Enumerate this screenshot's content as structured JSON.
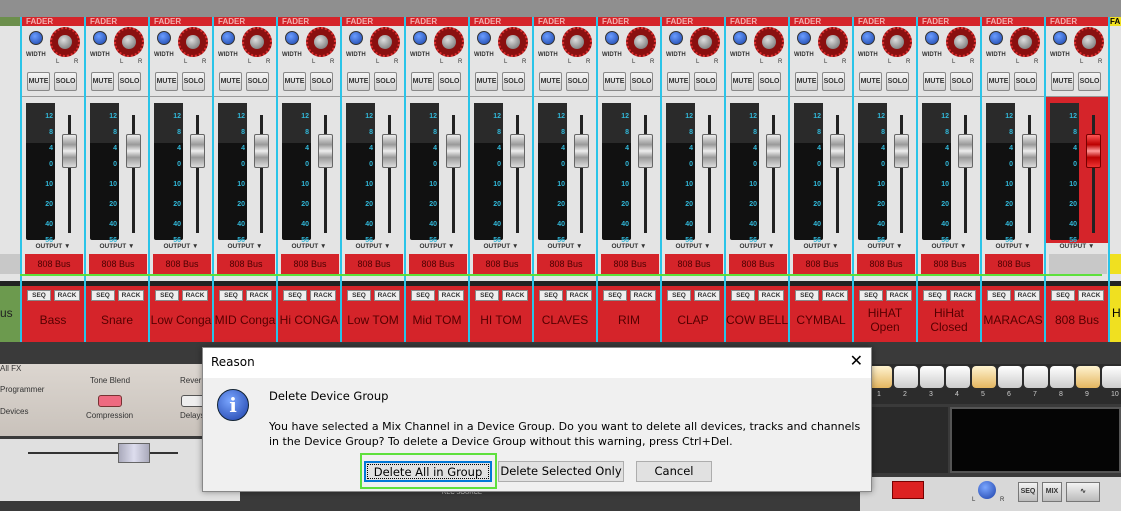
{
  "mixer": {
    "header_label": "FADER",
    "width_label": "WIDTH",
    "pan_l": "L",
    "pan_r": "R",
    "mute_label": "MUTE",
    "solo_label": "SOLO",
    "meter_scale": [
      "12",
      "8",
      "4",
      "0",
      "10",
      "20",
      "40",
      "56"
    ],
    "output_label": "OUTPUT",
    "seq_label": "SEQ",
    "rack_label": "RACK",
    "left_partial_name": "us",
    "right_partial_name": "H",
    "right_partial_header": "FA",
    "channels": [
      {
        "name": "Bass",
        "output": "808 Bus"
      },
      {
        "name": "Snare",
        "output": "808 Bus"
      },
      {
        "name": "Low Conga",
        "output": "808 Bus"
      },
      {
        "name": "MID Conga",
        "output": "808 Bus"
      },
      {
        "name": "Hi CONGA",
        "output": "808 Bus"
      },
      {
        "name": "Low TOM",
        "output": "808 Bus"
      },
      {
        "name": "Mid TOM",
        "output": "808 Bus"
      },
      {
        "name": "HI TOM",
        "output": "808 Bus"
      },
      {
        "name": "CLAVES",
        "output": "808 Bus"
      },
      {
        "name": "RIM",
        "output": "808 Bus"
      },
      {
        "name": "CLAP",
        "output": "808 Bus"
      },
      {
        "name": "COW BELL",
        "output": "808 Bus"
      },
      {
        "name": "CYMBAL",
        "output": "808 Bus"
      },
      {
        "name": "HiHAT Open",
        "output": "808 Bus"
      },
      {
        "name": "HiHat Closed",
        "output": "808 Bus"
      },
      {
        "name": "MARACAS",
        "output": "808 Bus"
      },
      {
        "name": "808 Bus",
        "output": "",
        "selected": true
      }
    ],
    "colors": {
      "strip": "#d5242a",
      "separator": "#2ac4e8",
      "selection": "#5ee03c"
    }
  },
  "rack": {
    "labels": {
      "all_fx": "All FX",
      "programmer": "Programmer",
      "devices": "Devices",
      "tone_blend": "Tone Blend",
      "reverb": "Rever",
      "compression": "Compression",
      "delays": "Delays",
      "rec_source": "REC SOURCE"
    },
    "steps": [
      "1",
      "2",
      "3",
      "4",
      "5",
      "6",
      "7",
      "8",
      "9",
      "10"
    ],
    "active_steps": [
      1,
      5,
      9
    ],
    "seq_button": "SEQ",
    "mix_button": "MIX",
    "pan_l": "L",
    "pan_r": "R"
  },
  "dialog": {
    "title": "Reason",
    "icon": "info-icon",
    "heading": "Delete Device Group",
    "message": "You have selected a Mix Channel in a Device Group. Do you want to delete all devices, tracks and channels in the Device Group? To delete a Device Group without this warning, press Ctrl+Del.",
    "buttons": {
      "delete_all": "Delete All in Group",
      "delete_selected": "Delete Selected Only",
      "cancel": "Cancel"
    },
    "close": "✕"
  }
}
